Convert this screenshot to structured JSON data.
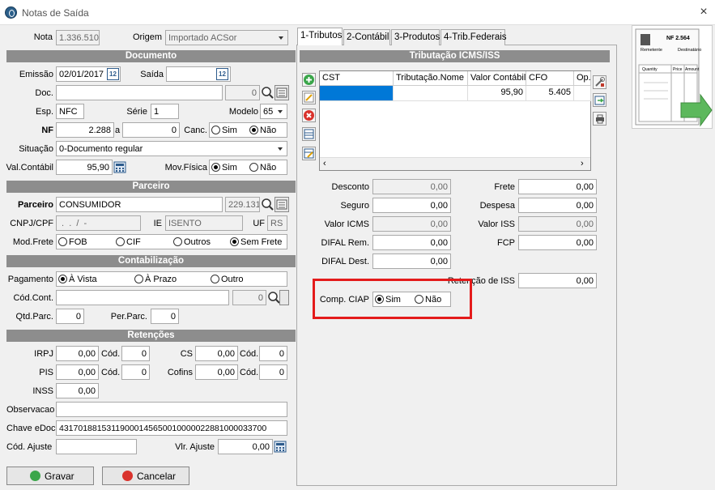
{
  "window": {
    "title": "Notas de Saída",
    "close_icon": "×"
  },
  "header": {
    "nota_label": "Nota",
    "nota_value": "1.336.510",
    "origem_label": "Origem",
    "origem_value": "Importado ACSor"
  },
  "documento": {
    "section_title": "Documento",
    "emissao_label": "Emissão",
    "emissao_value": "02/01/2017",
    "saida_label": "Saída",
    "saida_value": "",
    "doc_label": "Doc.",
    "doc_value": "",
    "doc_num": "0",
    "esp_label": "Esp.",
    "esp_value": "NFC",
    "serie_label": "Série",
    "serie_value": "1",
    "modelo_label": "Modelo",
    "modelo_value": "65",
    "nf_label": "NF",
    "nf_value": "2.288",
    "a_label": "a",
    "nf_to_value": "0",
    "canc_label": "Canc.",
    "canc_sim": "Sim",
    "canc_nao": "Não",
    "situacao_label": "Situação",
    "situacao_value": "0-Documento regular",
    "valcontabil_label": "Val.Contábil",
    "valcontabil_value": "95,90",
    "movfisica_label": "Mov.Física",
    "movfisica_sim": "Sim",
    "movfisica_nao": "Não",
    "calendar_glyph": "12"
  },
  "parceiro": {
    "section_title": "Parceiro",
    "parceiro_label": "Parceiro",
    "parceiro_value": "CONSUMIDOR",
    "parceiro_code": "229.131",
    "cnpj_label": "CNPJ/CPF",
    "cnpj_value": " .  .  /  -",
    "ie_label": "IE",
    "ie_value": "ISENTO",
    "uf_label": "UF",
    "uf_value": "RS",
    "modfrete_label": "Mod.Frete",
    "frete_options": [
      "FOB",
      "CIF",
      "Outros",
      "Sem Frete"
    ]
  },
  "contabilizacao": {
    "section_title": "Contabilização",
    "pagamento_label": "Pagamento",
    "pagamento_options": [
      "À Vista",
      "À Prazo",
      "Outro"
    ],
    "codcont_label": "Cód.Cont.",
    "codcont_value": "",
    "codcont_num": "0",
    "qtdparc_label": "Qtd.Parc.",
    "qtdparc_value": "0",
    "perparc_label": "Per.Parc.",
    "perparc_value": "0"
  },
  "retencoes": {
    "section_title": "Retenções",
    "irpj_label": "IRPJ",
    "irpj_value": "0,00",
    "irpj_cod_label": "Cód.",
    "irpj_cod_value": "0",
    "cs_label": "CS",
    "cs_value": "0,00",
    "cs_cod_label": "Cód.",
    "cs_cod_value": "0",
    "pis_label": "PIS",
    "pis_value": "0,00",
    "pis_cod_label": "Cód.",
    "pis_cod_value": "0",
    "cofins_label": "Cofins",
    "cofins_value": "0,00",
    "cofins_cod_label": "Cód.",
    "cofins_cod_value": "0",
    "inss_label": "INSS",
    "inss_value": "0,00"
  },
  "footer_fields": {
    "observacao_label": "Observacao",
    "observacao_value": "",
    "chave_label": "Chave eDoc",
    "chave_value": "43170188153119000145650010000022881000033700",
    "codajuste_label": "Cód. Ajuste",
    "codajuste_value": "",
    "vlrajuste_label": "Vlr. Ajuste",
    "vlrajuste_value": "0,00"
  },
  "buttons": {
    "gravar": "Gravar",
    "cancelar": "Cancelar"
  },
  "tabs": [
    {
      "label": "1-Tributos"
    },
    {
      "label": "2-Contábil"
    },
    {
      "label": "3-Produtos"
    },
    {
      "label": "4-Trib.Federais"
    }
  ],
  "tributos": {
    "section_title": "Tributação ICMS/ISS",
    "columns": [
      "CST",
      "Tributação.Nome",
      "Valor Contábil",
      "CFO",
      "Op."
    ],
    "rows": [
      [
        "",
        "",
        "95,90",
        "5.405",
        ""
      ]
    ],
    "desconto_label": "Desconto",
    "desconto_value": "0,00",
    "frete_label": "Frete",
    "frete_value": "0,00",
    "seguro_label": "Seguro",
    "seguro_value": "0,00",
    "despesa_label": "Despesa",
    "despesa_value": "0,00",
    "valoricms_label": "Valor ICMS",
    "valoricms_value": "0,00",
    "valoriss_label": "Valor ISS",
    "valoriss_value": "0,00",
    "difalrem_label": "DIFAL Rem.",
    "difalrem_value": "0,00",
    "fcp_label": "FCP",
    "fcp_value": "0,00",
    "difaldest_label": "DIFAL Dest.",
    "difaldest_value": "0,00",
    "retiss_label": "Retenção de ISS",
    "retiss_value": "0,00",
    "compciap_label": "Comp. CIAP",
    "compciap_sim": "Sim",
    "compciap_nao": "Não"
  },
  "nf_image": {
    "title": "NF 2.564",
    "remetente": "Remetente",
    "destinatario": "Destinatário",
    "cols": [
      "Quantity",
      "Price",
      "Amount"
    ]
  },
  "colors": {
    "section": "#8d8d8d",
    "highlight": "#e41b1b",
    "selection": "#0078d7"
  }
}
